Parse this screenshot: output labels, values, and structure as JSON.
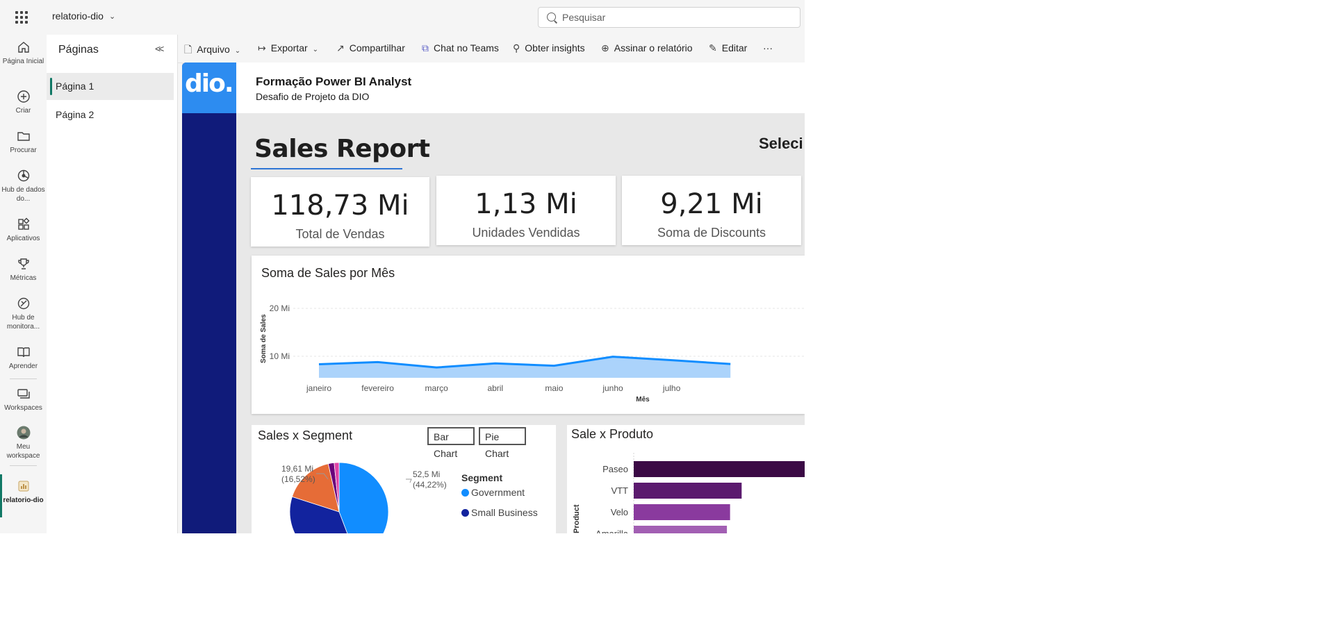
{
  "topbar": {
    "workspace_name": "relatorio-dio",
    "search_placeholder": "Pesquisar"
  },
  "leftnav": {
    "items": [
      {
        "label": "Página Inicial",
        "icon": "home-icon"
      },
      {
        "label": "Criar",
        "icon": "plus-circle-icon"
      },
      {
        "label": "Procurar",
        "icon": "folder-icon"
      },
      {
        "label": "Hub de dados do...",
        "icon": "data-hub-icon"
      },
      {
        "label": "Aplicativos",
        "icon": "apps-icon"
      },
      {
        "label": "Métricas",
        "icon": "trophy-icon"
      },
      {
        "label": "Hub de monitora...",
        "icon": "monitor-hub-icon"
      },
      {
        "label": "Aprender",
        "icon": "book-icon"
      },
      {
        "label": "Workspaces",
        "icon": "workspaces-icon"
      },
      {
        "label": "Meu workspace",
        "icon": "avatar-icon"
      },
      {
        "label": "relatorio-dio",
        "icon": "report-icon"
      }
    ]
  },
  "pages_pane": {
    "title": "Páginas",
    "pages": [
      {
        "label": "Página 1",
        "selected": true
      },
      {
        "label": "Página 2",
        "selected": false
      }
    ]
  },
  "toolbar": {
    "arquivo": "Arquivo",
    "exportar": "Exportar",
    "compartilhar": "Compartilhar",
    "chat_teams": "Chat no Teams",
    "insights": "Obter insights",
    "assinar": "Assinar o relatório",
    "editar": "Editar",
    "more": "···"
  },
  "report": {
    "logo_text": "dio.",
    "header_title": "Formação Power BI Analyst",
    "header_subtitle": "Desafio de Projeto da DIO",
    "title": "Sales Report",
    "slicer_label": "Seleci",
    "colors": {
      "strip": "#101b7a",
      "logo": "#2d8cf0",
      "accent": "#2d74d4"
    },
    "kpis": [
      {
        "value": "118,73 Mi",
        "label": "Total de Vendas"
      },
      {
        "value": "1,13 Mi",
        "label": "Unidades Vendidas"
      },
      {
        "value": "9,21 Mi",
        "label": "Soma de Discounts"
      }
    ],
    "segment_card": {
      "title": "Sales x Segment",
      "bar_button": "Bar Chart",
      "pie_button": "Pie Chart"
    },
    "product_card": {
      "title": "Sale x Produto"
    }
  },
  "chart_data": [
    {
      "type": "area",
      "title": "Soma de Sales por Mês",
      "xlabel": "Mês",
      "ylabel": "Soma de Sales",
      "yticks": [
        "20 Mi",
        "10 Mi"
      ],
      "ylim": [
        0,
        25
      ],
      "categories": [
        "janeiro",
        "fevereiro",
        "março",
        "abril",
        "maio",
        "junho",
        "julho"
      ],
      "values": [
        6.3,
        7.3,
        4.8,
        6.7,
        5.6,
        9.8,
        8.2
      ],
      "color": "#118dff",
      "fill": "#a7d1fb"
    },
    {
      "type": "pie",
      "title": "Sales x Segment",
      "legend_title": "Segment",
      "slices": [
        {
          "name": "Government",
          "value": 52.5,
          "label": "52,5 Mi",
          "pct": "(44,22%)",
          "color": "#118dff"
        },
        {
          "name": "Small Business",
          "value": 42.43,
          "color": "#12239e"
        },
        {
          "name": "",
          "value": 19.61,
          "label": "19,61 Mi",
          "pct": "(16,52%)",
          "color": "#e66c37"
        },
        {
          "name": "",
          "value": 2.3,
          "color": "#6b007b"
        },
        {
          "name": "",
          "value": 1.9,
          "color": "#e044a7"
        }
      ]
    },
    {
      "type": "bar",
      "title": "Sale x Produto",
      "ylabel": "Product",
      "categories": [
        "Paseo",
        "VTT",
        "Velo",
        "Amarilla"
      ],
      "values": [
        33,
        20.5,
        18.3,
        17.7
      ],
      "xmax": 33,
      "colors": [
        "#3b0a45",
        "#5b1a6e",
        "#8a3a9e",
        "#a25fb3"
      ]
    }
  ]
}
